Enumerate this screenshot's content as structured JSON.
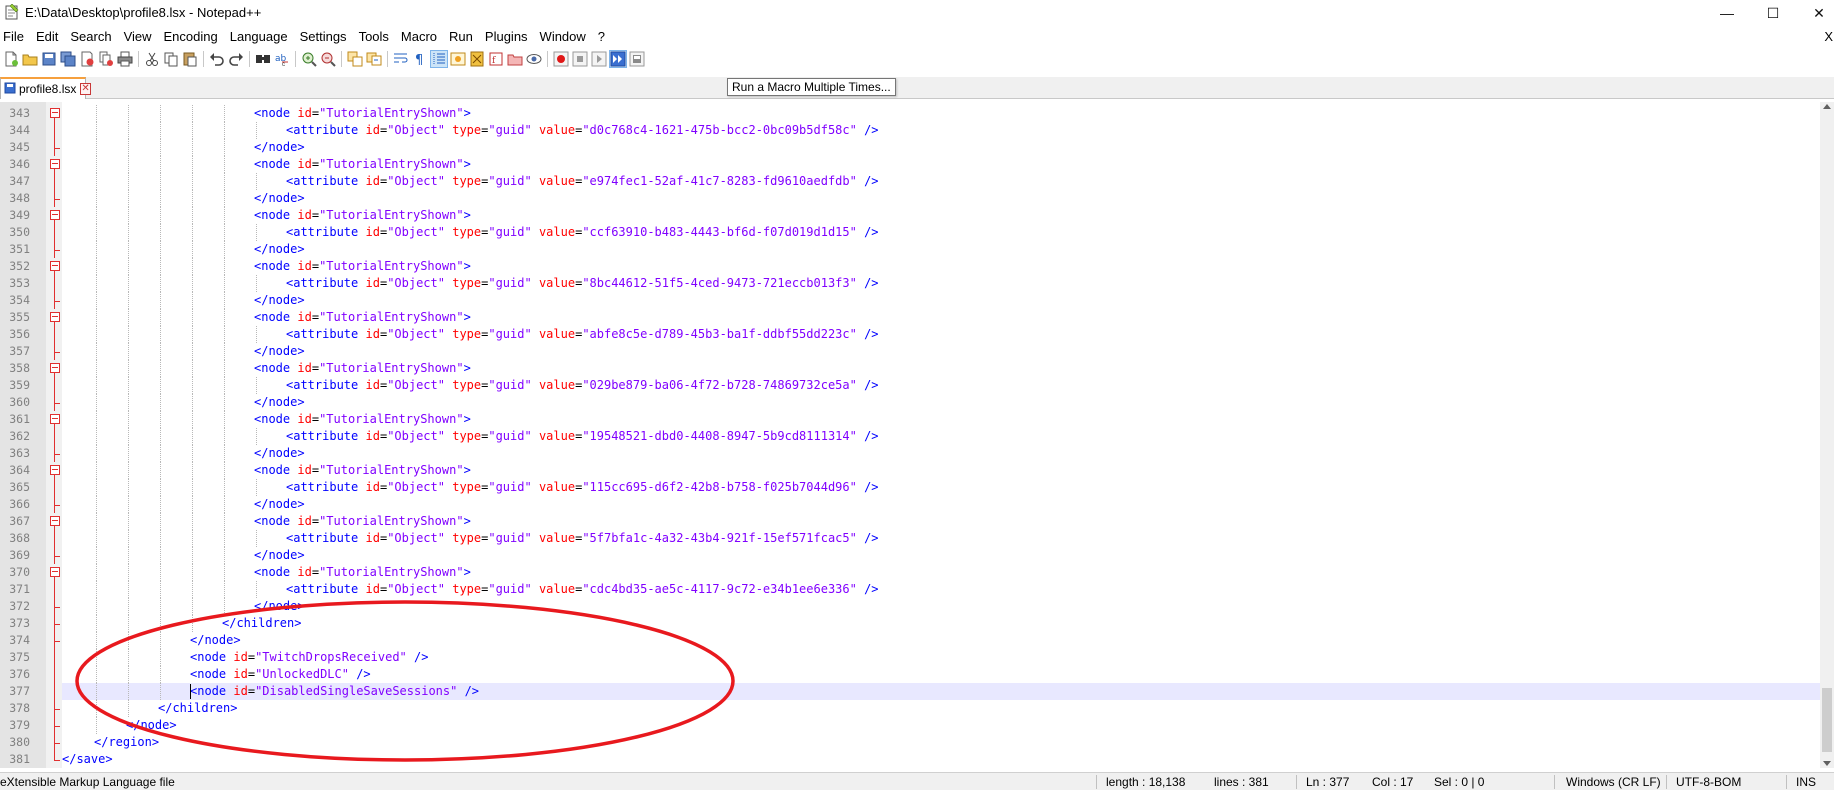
{
  "window": {
    "title": "E:\\Data\\Desktop\\profile8.lsx - Notepad++",
    "minimize": "—",
    "maximize": "☐",
    "close": "✕"
  },
  "menu": {
    "items": [
      "File",
      "Edit",
      "Search",
      "View",
      "Encoding",
      "Language",
      "Settings",
      "Tools",
      "Macro",
      "Run",
      "Plugins",
      "Window",
      "?"
    ],
    "close_x": "X"
  },
  "tabs": [
    {
      "label": "profile8.lsx",
      "close": "✕"
    }
  ],
  "tooltip": "Run a Macro Multiple Times...",
  "editor": {
    "lines": [
      {
        "n": "343",
        "indent": 6,
        "kind": "node",
        "id": "TutorialEntryShown",
        "fold": "open"
      },
      {
        "n": "344",
        "indent": 7,
        "kind": "attr",
        "guid": "d0c768c4-1621-475b-bcc2-0bc09b5df58c"
      },
      {
        "n": "345",
        "indent": 6,
        "kind": "close",
        "tag": "node",
        "fold": "end"
      },
      {
        "n": "346",
        "indent": 6,
        "kind": "node",
        "id": "TutorialEntryShown",
        "fold": "open"
      },
      {
        "n": "347",
        "indent": 7,
        "kind": "attr",
        "guid": "e974fec1-52af-41c7-8283-fd9610aedfdb"
      },
      {
        "n": "348",
        "indent": 6,
        "kind": "close",
        "tag": "node",
        "fold": "end"
      },
      {
        "n": "349",
        "indent": 6,
        "kind": "node",
        "id": "TutorialEntryShown",
        "fold": "open"
      },
      {
        "n": "350",
        "indent": 7,
        "kind": "attr",
        "guid": "ccf63910-b483-4443-bf6d-f07d019d1d15"
      },
      {
        "n": "351",
        "indent": 6,
        "kind": "close",
        "tag": "node",
        "fold": "end"
      },
      {
        "n": "352",
        "indent": 6,
        "kind": "node",
        "id": "TutorialEntryShown",
        "fold": "open"
      },
      {
        "n": "353",
        "indent": 7,
        "kind": "attr",
        "guid": "8bc44612-51f5-4ced-9473-721eccb013f3"
      },
      {
        "n": "354",
        "indent": 6,
        "kind": "close",
        "tag": "node",
        "fold": "end"
      },
      {
        "n": "355",
        "indent": 6,
        "kind": "node",
        "id": "TutorialEntryShown",
        "fold": "open"
      },
      {
        "n": "356",
        "indent": 7,
        "kind": "attr",
        "guid": "abfe8c5e-d789-45b3-ba1f-ddbf55dd223c"
      },
      {
        "n": "357",
        "indent": 6,
        "kind": "close",
        "tag": "node",
        "fold": "end"
      },
      {
        "n": "358",
        "indent": 6,
        "kind": "node",
        "id": "TutorialEntryShown",
        "fold": "open"
      },
      {
        "n": "359",
        "indent": 7,
        "kind": "attr",
        "guid": "029be879-ba06-4f72-b728-74869732ce5a"
      },
      {
        "n": "360",
        "indent": 6,
        "kind": "close",
        "tag": "node",
        "fold": "end"
      },
      {
        "n": "361",
        "indent": 6,
        "kind": "node",
        "id": "TutorialEntryShown",
        "fold": "open"
      },
      {
        "n": "362",
        "indent": 7,
        "kind": "attr",
        "guid": "19548521-dbd0-4408-8947-5b9cd8111314"
      },
      {
        "n": "363",
        "indent": 6,
        "kind": "close",
        "tag": "node",
        "fold": "end"
      },
      {
        "n": "364",
        "indent": 6,
        "kind": "node",
        "id": "TutorialEntryShown",
        "fold": "open"
      },
      {
        "n": "365",
        "indent": 7,
        "kind": "attr",
        "guid": "115cc695-d6f2-42b8-b758-f025b7044d96"
      },
      {
        "n": "366",
        "indent": 6,
        "kind": "close",
        "tag": "node",
        "fold": "end"
      },
      {
        "n": "367",
        "indent": 6,
        "kind": "node",
        "id": "TutorialEntryShown",
        "fold": "open"
      },
      {
        "n": "368",
        "indent": 7,
        "kind": "attr",
        "guid": "5f7bfa1c-4a32-43b4-921f-15ef571fcac5"
      },
      {
        "n": "369",
        "indent": 6,
        "kind": "close",
        "tag": "node",
        "fold": "end"
      },
      {
        "n": "370",
        "indent": 6,
        "kind": "node",
        "id": "TutorialEntryShown",
        "fold": "open"
      },
      {
        "n": "371",
        "indent": 7,
        "kind": "attr",
        "guid": "cdc4bd35-ae5c-4117-9c72-e34b1ee6e336"
      },
      {
        "n": "372",
        "indent": 6,
        "kind": "close",
        "tag": "node",
        "fold": "end"
      },
      {
        "n": "373",
        "indent": 5,
        "kind": "close",
        "tag": "children",
        "fold": "end"
      },
      {
        "n": "374",
        "indent": 4,
        "kind": "close",
        "tag": "node",
        "fold": "end"
      },
      {
        "n": "375",
        "indent": 4,
        "kind": "selfnode",
        "id": "TwitchDropsReceived"
      },
      {
        "n": "376",
        "indent": 4,
        "kind": "selfnode",
        "id": "UnlockedDLC"
      },
      {
        "n": "377",
        "indent": 4,
        "kind": "selfnode",
        "id": "DisabledSingleSaveSessions",
        "current": true
      },
      {
        "n": "378",
        "indent": 3,
        "kind": "close",
        "tag": "children",
        "fold": "end"
      },
      {
        "n": "379",
        "indent": 2,
        "kind": "close",
        "tag": "node",
        "fold": "end"
      },
      {
        "n": "380",
        "indent": 1,
        "kind": "close",
        "tag": "region",
        "fold": "end"
      },
      {
        "n": "381",
        "indent": 0,
        "kind": "close",
        "tag": "save",
        "fold": "last"
      }
    ],
    "attr_id": "Object",
    "attr_type": "guid"
  },
  "status": {
    "filetype": "eXtensible Markup Language file",
    "length": "length : 18,138",
    "lines": "lines : 381",
    "ln": "Ln : 377",
    "col": "Col : 17",
    "sel": "Sel : 0 | 0",
    "eol": "Windows (CR LF)",
    "encoding": "UTF-8-BOM",
    "mode": "INS"
  },
  "colors": {
    "annotation": "#e8191e",
    "tag": "#0000ff",
    "attribute": "#ff0000",
    "value": "#8000ff",
    "current_line": "#e8e8ff"
  }
}
